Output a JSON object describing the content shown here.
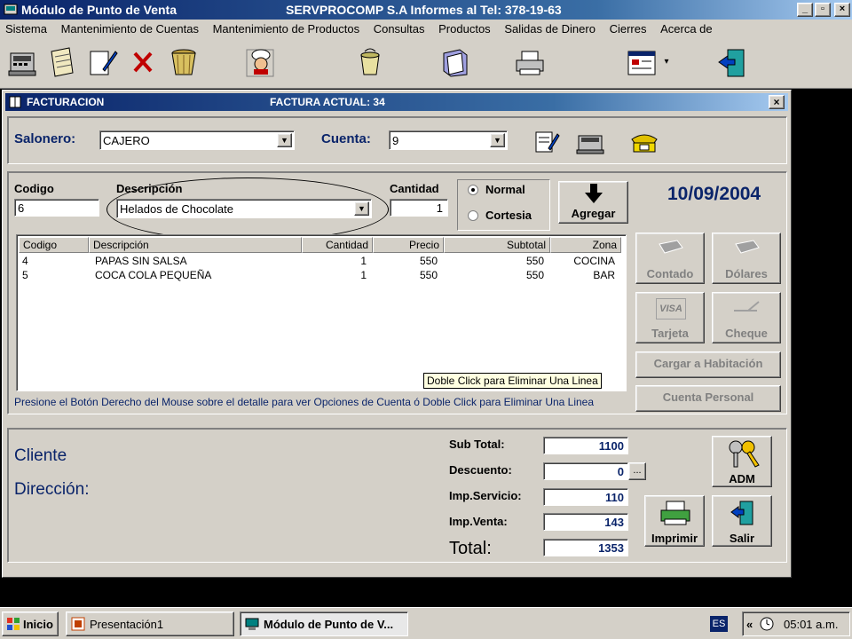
{
  "app": {
    "title": "Módulo de Punto de Venta",
    "company": "SERVPROCOMP S.A  Informes al Tel:  378-19-63",
    "min": "_",
    "max": "▫",
    "close": "×"
  },
  "menu": [
    "Sistema",
    "Mantenimiento de Cuentas",
    "Mantenimiento de Productos",
    "Consultas",
    "Productos",
    "Salidas de Dinero",
    "Cierres",
    "Acerca de"
  ],
  "toolbar": {
    "icons": [
      "cash-register-icon",
      "notebook-icon",
      "edit-document-icon",
      "delete-x-icon",
      "basket-icon",
      "chef-icon",
      "trash-bin-icon",
      "folder-icon",
      "printer-icon",
      "report-icon",
      "exit-door-icon"
    ],
    "dropdown_arrow": "▾"
  },
  "facturacion": {
    "title": "FACTURACION",
    "current_invoice_label": "FACTURA ACTUAL:  34",
    "close": "×",
    "salonero_label": "Salonero:",
    "salonero_value": "CAJERO",
    "cuenta_label": "Cuenta:",
    "cuenta_value": "9",
    "codigo_label": "Codigo",
    "codigo_value": "6",
    "descripcion_label": "Descripción",
    "descripcion_value": "Helados de Chocolate",
    "cantidad_label": "Cantidad",
    "cantidad_value": "1",
    "radio_normal": "Normal",
    "radio_cortesia": "Cortesia",
    "selected_mode": "Normal",
    "agregar_label": "Agregar",
    "date": "10/09/2004",
    "grid": {
      "columns": [
        "Codigo",
        "Descripción",
        "Cantidad",
        "Precio",
        "Subtotal",
        "Zona"
      ],
      "rows": [
        {
          "codigo": "4",
          "descripcion": "PAPAS SIN SALSA",
          "cantidad": "1",
          "precio": "550",
          "subtotal": "550",
          "zona": "COCINA"
        },
        {
          "codigo": "5",
          "descripcion": "COCA COLA PEQUEÑA",
          "cantidad": "1",
          "precio": "550",
          "subtotal": "550",
          "zona": "BAR"
        }
      ]
    },
    "tooltip": "Doble Click para Eliminar Una Linea",
    "hint": "Presione el Botón Derecho del Mouse sobre el detalle para ver Opciones de Cuenta ó Doble Click para Eliminar Una Linea",
    "payment": {
      "contado": "Contado",
      "dolares": "Dólares",
      "tarjeta": "Tarjeta",
      "visa": "VISA",
      "cheque": "Cheque",
      "cargar": "Cargar a Habitación",
      "cuenta_personal": "Cuenta Personal"
    },
    "cliente_label": "Cliente",
    "direccion_label": "Dirección:",
    "totals": {
      "subtotal_label": "Sub Total:",
      "subtotal": "1100",
      "descuento_label": "Descuento:",
      "descuento": "0",
      "descuento_btn": "...",
      "servicio_label": "Imp.Servicio:",
      "servicio": "110",
      "venta_label": "Imp.Venta:",
      "venta": "143",
      "total_label": "Total:",
      "total": "1353"
    },
    "adm_label": "ADM",
    "imprimir_label": "Imprimir",
    "salir_label": "Salir"
  },
  "taskbar": {
    "start": "Inicio",
    "task1": "Presentación1",
    "task2": "Módulo de Punto de V...",
    "lang": "ES",
    "chevron": "«",
    "clock": "05:01 a.m."
  }
}
